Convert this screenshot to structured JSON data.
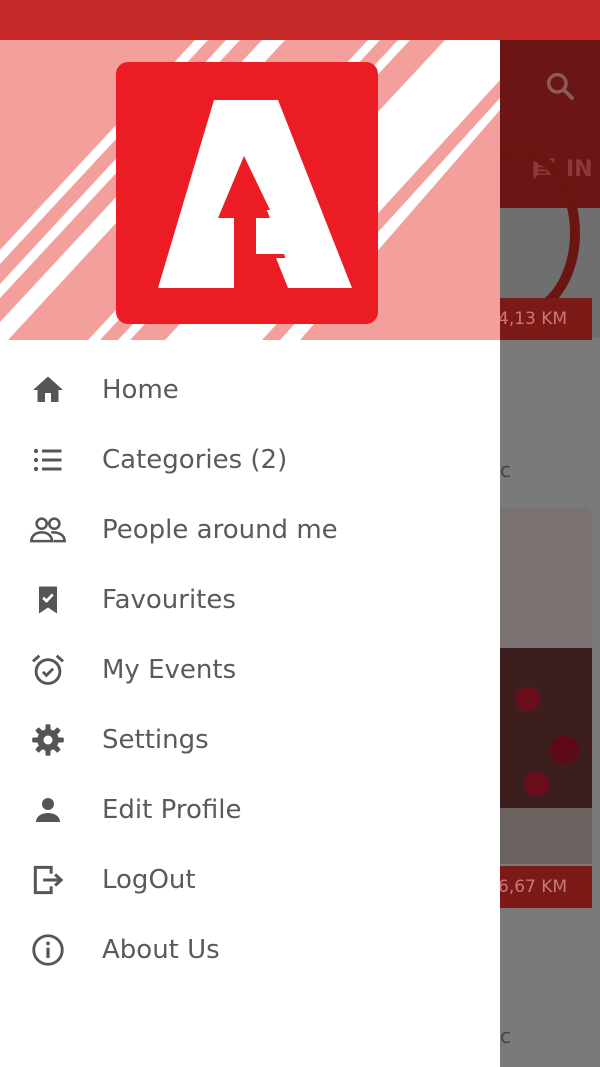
{
  "behind": {
    "tab_label": "IN",
    "distance_1": "4,13 KM",
    "distance_2": "6,67 KM",
    "partial_text_1": "c",
    "partial_text_2": "c"
  },
  "colors": {
    "status_bar": "#c62828",
    "logo_red": "#ec1c24",
    "stripe_pink": "#f3a09c",
    "menu_text": "#5a5a5a",
    "icon_gray": "#555555"
  },
  "menu": {
    "items": [
      {
        "label": "Home",
        "icon": "home-icon"
      },
      {
        "label": "Categories (2)",
        "icon": "list-icon"
      },
      {
        "label": "People around me",
        "icon": "people-icon"
      },
      {
        "label": "Favourites",
        "icon": "bookmark-check-icon"
      },
      {
        "label": "My Events",
        "icon": "alarm-check-icon"
      },
      {
        "label": "Settings",
        "icon": "gear-icon"
      },
      {
        "label": "Edit Profile",
        "icon": "person-icon"
      },
      {
        "label": "LogOut",
        "icon": "logout-icon"
      },
      {
        "label": "About Us",
        "icon": "info-icon"
      }
    ]
  }
}
